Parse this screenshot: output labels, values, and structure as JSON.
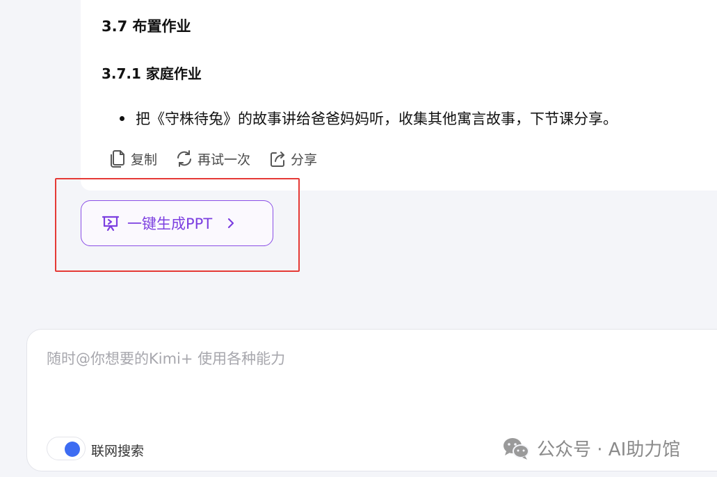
{
  "answer": {
    "heading": "3.7 布置作业",
    "subheading": "3.7.1 家庭作业",
    "bullet": "把《守株待兔》的故事讲给爸爸妈妈听，收集其他寓言故事，下节课分享。",
    "actions": {
      "copy": "复制",
      "retry": "再试一次",
      "share": "分享"
    }
  },
  "ppt_button": {
    "label": "一键生成PPT"
  },
  "input": {
    "placeholder": "随时@你想要的Kimi+ 使用各种能力",
    "web_search_label": "联网搜索",
    "web_search_on": true
  },
  "watermark": {
    "text": "公众号 · AI助力馆"
  },
  "colors": {
    "accent_purple": "#7c3fe0",
    "annotation_red": "#e53935",
    "toggle_blue": "#3d6cf2",
    "background": "#f4f5f9"
  },
  "icons": {
    "copy": "copy-icon",
    "retry": "refresh-icon",
    "share": "share-icon",
    "ppt": "presentation-icon",
    "chevron": "chevron-right-icon",
    "watermark": "wechat-icon"
  }
}
